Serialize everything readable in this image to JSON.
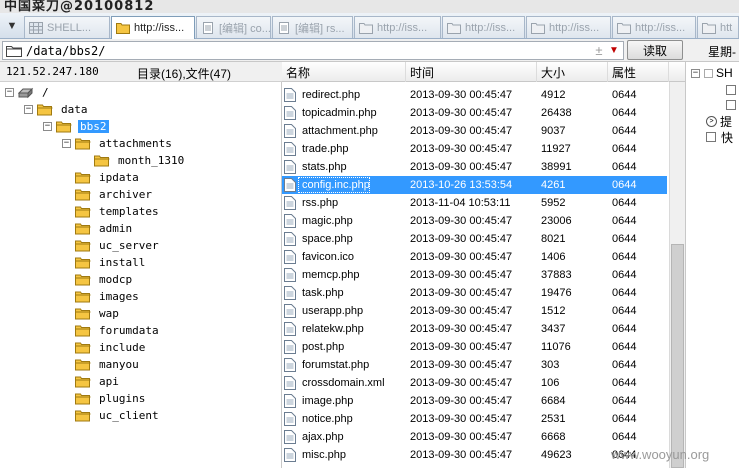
{
  "window": {
    "title": "中国菜刀@20100812"
  },
  "tabs": [
    {
      "label": "SHELL..."
    },
    {
      "label": "http://iss..."
    },
    {
      "label": "[编辑] co..."
    },
    {
      "label": "[编辑] rs..."
    },
    {
      "label": "http://iss..."
    },
    {
      "label": "http://iss..."
    },
    {
      "label": "http://iss..."
    },
    {
      "label": "http://iss..."
    },
    {
      "label": "htt"
    }
  ],
  "address": {
    "path": "/data/bbs2/",
    "plus": "±",
    "read_label": "读取",
    "week_label": "星期-"
  },
  "info": {
    "ip": "121.52.247.180",
    "counts": "目录(16),文件(47)"
  },
  "tree": {
    "root": "/",
    "data": "data",
    "bbs2": "bbs2",
    "attachments": "attachments",
    "month": "month_1310",
    "folders": [
      "ipdata",
      "archiver",
      "templates",
      "admin",
      "uc_server",
      "install",
      "modcp",
      "images",
      "wap",
      "forumdata",
      "include",
      "manyou",
      "api",
      "plugins",
      "uc_client"
    ]
  },
  "list": {
    "headers": {
      "name": "名称",
      "time": "时间",
      "size": "大小",
      "attr": "属性"
    },
    "rows": [
      {
        "name": "redirect.php",
        "time": "2013-09-30 00:45:47",
        "size": "4912",
        "attr": "0644"
      },
      {
        "name": "topicadmin.php",
        "time": "2013-09-30 00:45:47",
        "size": "26438",
        "attr": "0644"
      },
      {
        "name": "attachment.php",
        "time": "2013-09-30 00:45:47",
        "size": "9037",
        "attr": "0644"
      },
      {
        "name": "trade.php",
        "time": "2013-09-30 00:45:47",
        "size": "11927",
        "attr": "0644"
      },
      {
        "name": "stats.php",
        "time": "2013-09-30 00:45:47",
        "size": "38991",
        "attr": "0644"
      },
      {
        "name": "config.inc.php",
        "time": "2013-10-26 13:53:54",
        "size": "4261",
        "attr": "0644"
      },
      {
        "name": "rss.php",
        "time": "2013-11-04 10:53:11",
        "size": "5952",
        "attr": "0644"
      },
      {
        "name": "magic.php",
        "time": "2013-09-30 00:45:47",
        "size": "23006",
        "attr": "0644"
      },
      {
        "name": "space.php",
        "time": "2013-09-30 00:45:47",
        "size": "8021",
        "attr": "0644"
      },
      {
        "name": "favicon.ico",
        "time": "2013-09-30 00:45:47",
        "size": "1406",
        "attr": "0644"
      },
      {
        "name": "memcp.php",
        "time": "2013-09-30 00:45:47",
        "size": "37883",
        "attr": "0644"
      },
      {
        "name": "task.php",
        "time": "2013-09-30 00:45:47",
        "size": "19476",
        "attr": "0644"
      },
      {
        "name": "userapp.php",
        "time": "2013-09-30 00:45:47",
        "size": "1512",
        "attr": "0644"
      },
      {
        "name": "relatekw.php",
        "time": "2013-09-30 00:45:47",
        "size": "3437",
        "attr": "0644"
      },
      {
        "name": "post.php",
        "time": "2013-09-30 00:45:47",
        "size": "11076",
        "attr": "0644"
      },
      {
        "name": "forumstat.php",
        "time": "2013-09-30 00:45:47",
        "size": "303",
        "attr": "0644"
      },
      {
        "name": "crossdomain.xml",
        "time": "2013-09-30 00:45:47",
        "size": "106",
        "attr": "0644"
      },
      {
        "name": "image.php",
        "time": "2013-09-30 00:45:47",
        "size": "6684",
        "attr": "0644"
      },
      {
        "name": "notice.php",
        "time": "2013-09-30 00:45:47",
        "size": "2531",
        "attr": "0644"
      },
      {
        "name": "ajax.php",
        "time": "2013-09-30 00:45:47",
        "size": "6668",
        "attr": "0644"
      },
      {
        "name": "misc.php",
        "time": "2013-09-30 00:45:47",
        "size": "49623",
        "attr": "0644"
      }
    ],
    "selected_index": 5
  },
  "right_panel": {
    "root_label": "SH",
    "item1": "提",
    "item2": "快"
  },
  "watermark": "www.wooyun.org",
  "colors": {
    "selection": "#3399ff",
    "folder": "#f5c542",
    "tab_border": "#7f9db9"
  }
}
